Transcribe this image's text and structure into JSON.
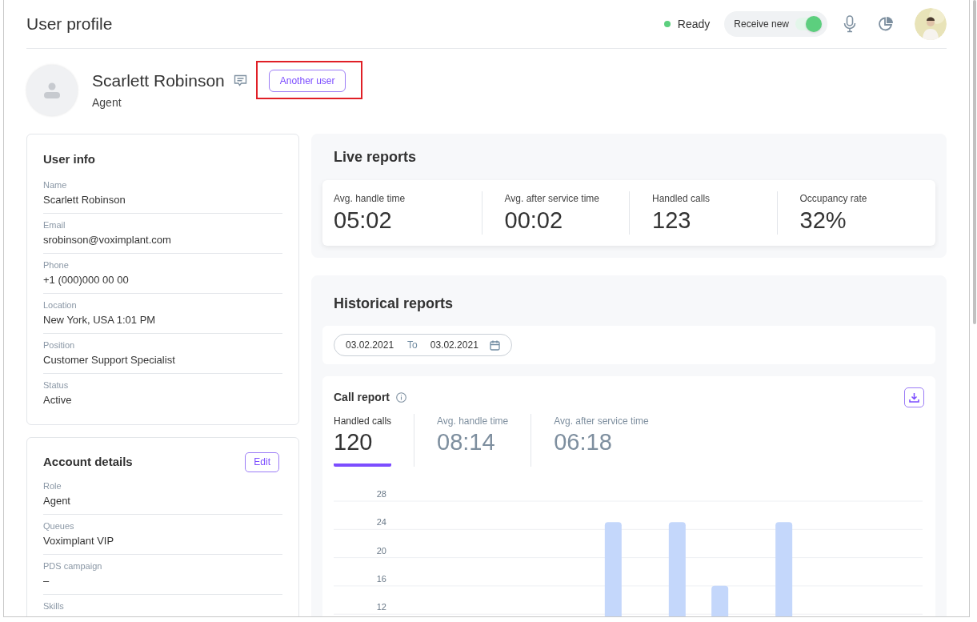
{
  "header": {
    "title": "User profile",
    "status": "Ready",
    "receive_toggle": {
      "label": "Receive new",
      "on": true
    }
  },
  "profile": {
    "name": "Scarlett Robinson",
    "role": "Agent",
    "button": "Another user"
  },
  "user_info": {
    "title": "User info",
    "fields": [
      {
        "label": "Name",
        "value": "Scarlett Robinson"
      },
      {
        "label": "Email",
        "value": "srobinson@voximplant.com"
      },
      {
        "label": "Phone",
        "value": "+1 (000)000 00 00"
      },
      {
        "label": "Location",
        "value": "New York, USA 1:01 PM"
      },
      {
        "label": "Position",
        "value": "Customer Support Specialist"
      },
      {
        "label": "Status",
        "value": "Active"
      }
    ]
  },
  "account_details": {
    "title": "Account details",
    "edit": "Edit",
    "fields": [
      {
        "label": "Role",
        "value": "Agent"
      },
      {
        "label": "Queues",
        "value": "Voximplant VIP"
      },
      {
        "label": "PDS campaign",
        "value": "–"
      },
      {
        "label": "Skills"
      }
    ]
  },
  "live_reports": {
    "title": "Live reports",
    "metrics": [
      {
        "label": "Avg. handle time",
        "value": "05:02"
      },
      {
        "label": "Avg. after service time",
        "value": "00:02"
      },
      {
        "label": "Handled calls",
        "value": "123"
      },
      {
        "label": "Occupancy rate",
        "value": "32%"
      }
    ]
  },
  "historical_reports": {
    "title": "Historical reports",
    "date_from": "03.02.2021",
    "separator": "To",
    "date_to": "03.02.2021",
    "call_report": {
      "title": "Call report",
      "tabs": [
        {
          "label": "Handled calls",
          "value": "120",
          "selected": true
        },
        {
          "label": "Avg. handle time",
          "value": "08:14",
          "selected": false
        },
        {
          "label": "Avg. after service time",
          "value": "06:18",
          "selected": false
        }
      ],
      "chart": {
        "axis_labels": [
          "28",
          "24",
          "20",
          "16",
          "12"
        ]
      }
    }
  }
}
